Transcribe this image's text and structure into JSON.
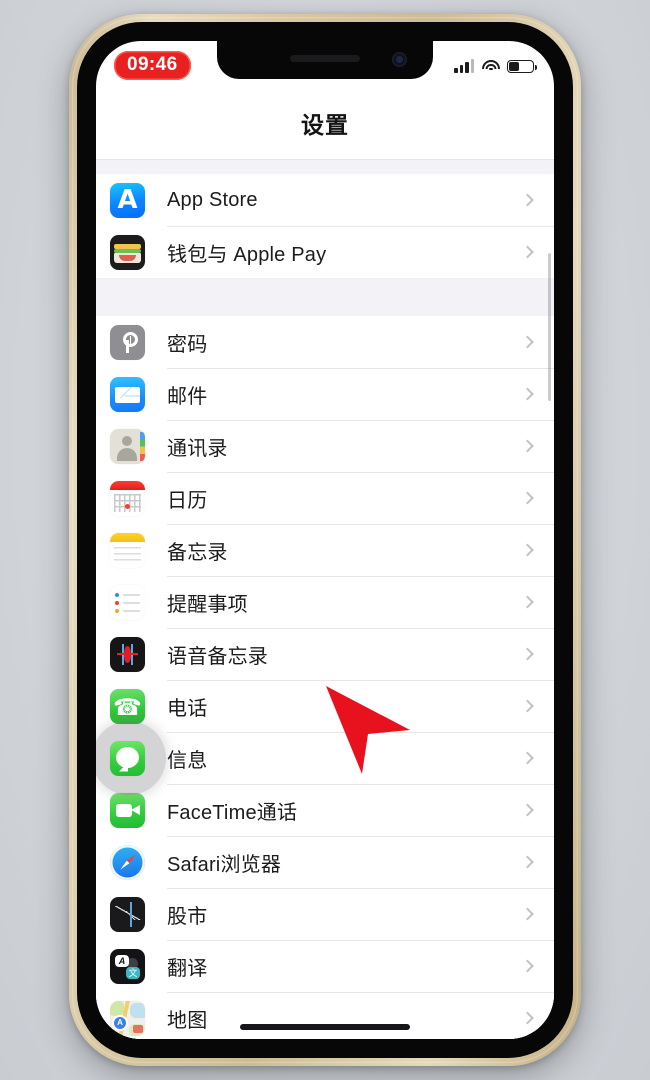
{
  "device": {
    "frame_color": "#d8c9a4",
    "backdrop_color": "#d5d8dc"
  },
  "status_bar": {
    "time": "09:46",
    "recording_pill_color": "#e8201f",
    "cellular_icon": "cellular-bars-icon",
    "cellular_bars_filled": 3,
    "cellular_bars_total": 4,
    "wifi_icon": "wifi-icon",
    "battery_icon": "battery-icon",
    "battery_level_percent": 40
  },
  "nav": {
    "title": "设置"
  },
  "list": {
    "groups": [
      {
        "rows": [
          {
            "icon": "app-store-icon",
            "icon_class": "ic-appstore",
            "label": "App Store"
          },
          {
            "icon": "wallet-apple-pay-icon",
            "icon_class": "ic-wallet",
            "label": "钱包与 Apple Pay"
          }
        ]
      },
      {
        "rows": [
          {
            "icon": "passwords-icon",
            "icon_class": "ic-passwords",
            "label": "密码"
          },
          {
            "icon": "mail-icon",
            "icon_class": "ic-mail",
            "label": "邮件"
          },
          {
            "icon": "contacts-icon",
            "icon_class": "ic-contacts",
            "label": "通讯录"
          },
          {
            "icon": "calendar-icon",
            "icon_class": "ic-calendar",
            "label": "日历"
          },
          {
            "icon": "notes-icon",
            "icon_class": "ic-notes",
            "label": "备忘录"
          },
          {
            "icon": "reminders-icon",
            "icon_class": "ic-reminders",
            "label": "提醒事项"
          },
          {
            "icon": "voice-memos-icon",
            "icon_class": "ic-voice",
            "label": "语音备忘录"
          },
          {
            "icon": "phone-icon",
            "icon_class": "ic-phone",
            "label": "电话"
          },
          {
            "icon": "messages-icon",
            "icon_class": "ic-messages",
            "label": "信息",
            "tapped": true
          },
          {
            "icon": "facetime-icon",
            "icon_class": "ic-facetime",
            "label": "FaceTime通话"
          },
          {
            "icon": "safari-icon",
            "icon_class": "ic-safari",
            "label": "Safari浏览器"
          },
          {
            "icon": "stocks-icon",
            "icon_class": "ic-stocks",
            "label": "股市"
          },
          {
            "icon": "translate-icon",
            "icon_class": "ic-translate",
            "label": "翻译"
          },
          {
            "icon": "maps-icon",
            "icon_class": "ic-maps",
            "label": "地图"
          }
        ]
      }
    ],
    "disclosure_icon": "chevron-right-icon",
    "disclosure_color": "#c2c2c7"
  },
  "overlay": {
    "tap_highlight": "tap-highlight-circle",
    "cursor": "mouse-cursor-arrow",
    "cursor_color": "#e8121f"
  },
  "home_indicator": "home-indicator-bar"
}
